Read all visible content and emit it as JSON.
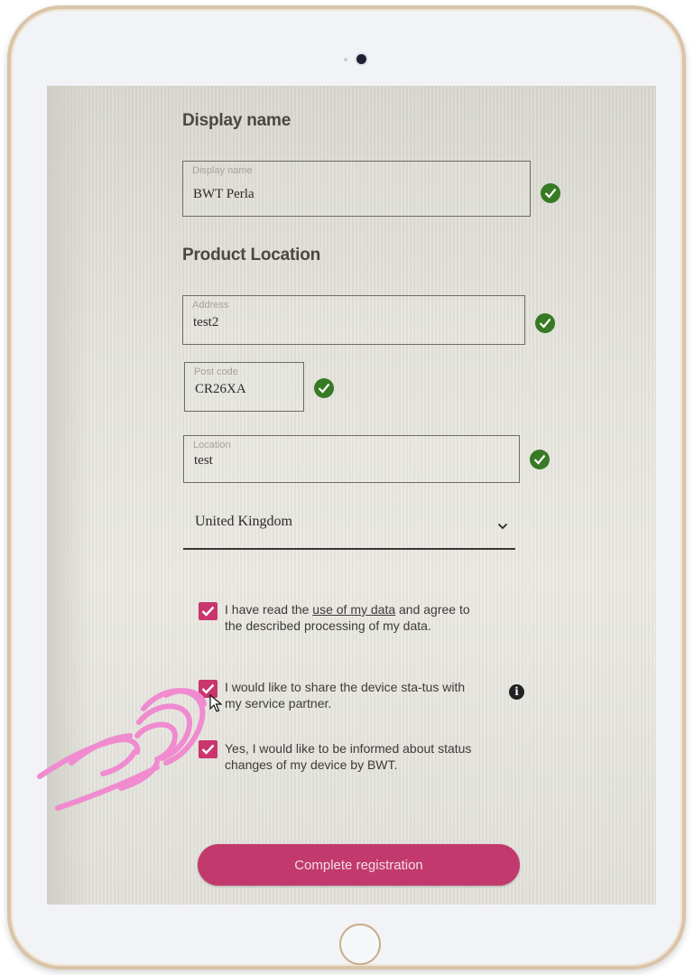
{
  "display_name_section": {
    "title": "Display name",
    "field_label": "Display name",
    "field_value": "BWT Perla"
  },
  "product_location_section": {
    "title": "Product Location",
    "address_label": "Address",
    "address_value": "test2",
    "postcode_label": "Post code",
    "postcode_value": "CR26XA",
    "location_label": "Location",
    "location_value": "test",
    "country_value": "United Kingdom"
  },
  "consents": [
    {
      "text_before": "I have read the ",
      "link_text": "use of my data",
      "text_after": " and agree to the described processing of my data.",
      "checked": true
    },
    {
      "text": "I would like to share the device sta-tus with my service partner.",
      "checked": true
    },
    {
      "text": "Yes, I would like to be informed about status changes of my device by BWT.",
      "checked": true
    }
  ],
  "submit_label": "Complete registration",
  "colors": {
    "accent": "#c23a6d",
    "valid": "#367a24",
    "gesture": "#f08bd0"
  },
  "icons": [
    "check-circle-icon",
    "chevron-down-icon",
    "info-icon",
    "cursor-icon",
    "tap-gesture-icon"
  ]
}
